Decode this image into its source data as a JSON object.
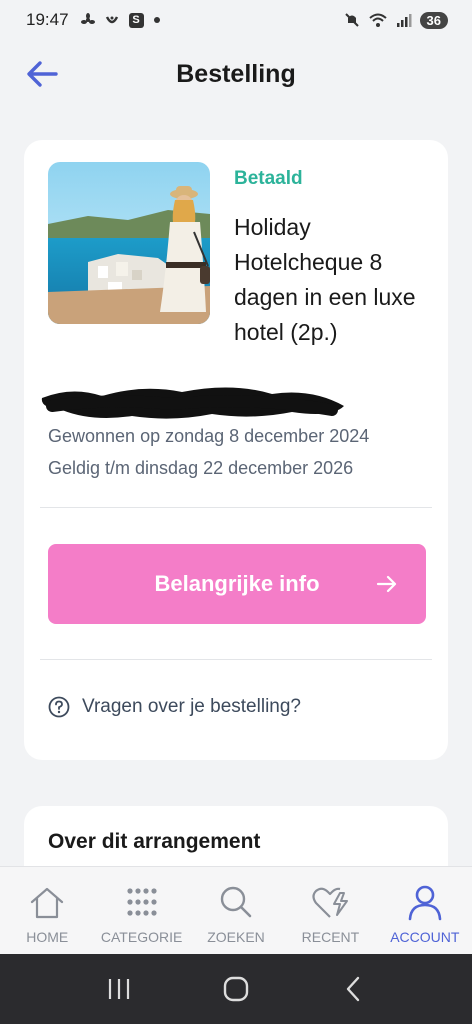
{
  "status_bar": {
    "time": "19:47",
    "notif_box_label": "S",
    "battery": "36"
  },
  "header": {
    "title": "Bestelling",
    "back_icon": "arrow-left-icon",
    "accent": "#4f63d6"
  },
  "order": {
    "status": "Betaald",
    "status_color": "#2cb39a",
    "title": "Holiday Hotelcheque 8 dagen in een luxe hotel (2p.)",
    "won_on": "Gewonnen op zondag 8 december 2024",
    "valid_until": "Geldig t/m dinsdag 22 december 2026",
    "info_button": "Belangrijke info",
    "info_button_color": "#f47dc8",
    "question_link": "Vragen over je bestelling?"
  },
  "arrangement": {
    "title": "Over dit arrangement"
  },
  "bottom_nav": {
    "items": [
      {
        "label": "HOME",
        "icon": "home-icon"
      },
      {
        "label": "CATEGORIE",
        "icon": "grid-icon"
      },
      {
        "label": "ZOEKEN",
        "icon": "search-icon"
      },
      {
        "label": "RECENT",
        "icon": "heart-bolt-icon"
      },
      {
        "label": "ACCOUNT",
        "icon": "user-icon",
        "active": true
      }
    ]
  }
}
